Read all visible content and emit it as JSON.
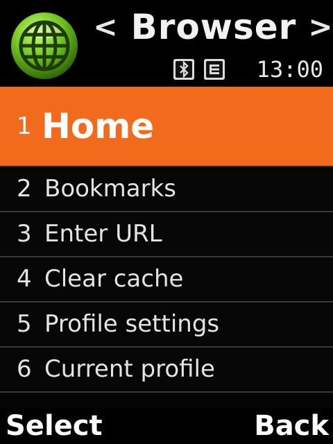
{
  "header": {
    "title": "Browser",
    "prev_arrow": "<",
    "next_arrow": ">",
    "app_icon": "globe-icon",
    "status": {
      "bluetooth_icon": "bluetooth-icon",
      "message_icon": "message-icon",
      "time": "13:00"
    }
  },
  "menu": {
    "items": [
      {
        "number": "1",
        "label": "Home",
        "selected": true
      },
      {
        "number": "2",
        "label": "Bookmarks",
        "selected": false
      },
      {
        "number": "3",
        "label": "Enter URL",
        "selected": false
      },
      {
        "number": "4",
        "label": "Clear cache",
        "selected": false
      },
      {
        "number": "5",
        "label": "Profile settings",
        "selected": false
      },
      {
        "number": "6",
        "label": "Current profile",
        "selected": false
      }
    ]
  },
  "softkeys": {
    "left": "Select",
    "right": "Back"
  },
  "colors": {
    "accent": "#f26b1d",
    "background": "#050505",
    "text": "#e4e4e4",
    "divider": "#3a3a3a",
    "globe_green": "#6fc21f"
  }
}
